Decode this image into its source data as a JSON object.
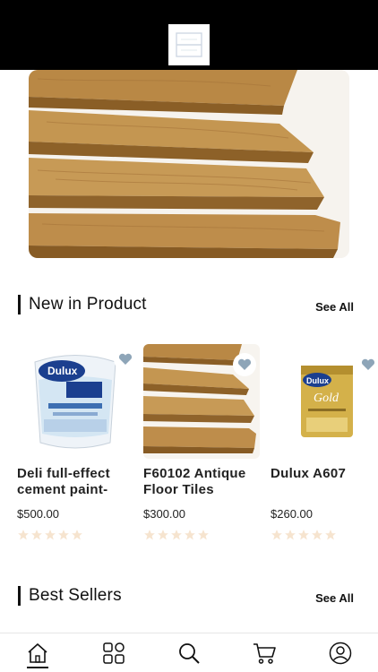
{
  "header": {
    "logo_icon": "store-logo-icon"
  },
  "banner": {
    "image": "wood-floor-planks"
  },
  "new_in_product": {
    "title": "New in Product",
    "see_all": "See All",
    "items": [
      {
        "name": "Deli full-effect cement paint-",
        "price": "$500.00",
        "rating": 0,
        "image": "dulux-paint-bucket"
      },
      {
        "name": "F60102 Antique Floor Tiles",
        "price": "$300.00",
        "rating": 0,
        "image": "wood-floor-planks"
      },
      {
        "name": "Dulux A607",
        "price": "$260.00",
        "rating": 0,
        "image": "dulux-gold-can"
      }
    ]
  },
  "best_sellers": {
    "title": "Best Sellers",
    "see_all": "See All"
  },
  "bottom_nav": [
    {
      "icon": "home-icon",
      "active": true
    },
    {
      "icon": "categories-icon",
      "active": false
    },
    {
      "icon": "search-icon",
      "active": false
    },
    {
      "icon": "cart-icon",
      "active": false
    },
    {
      "icon": "profile-icon",
      "active": false
    }
  ],
  "colors": {
    "star": "#f6e4cf",
    "heart": "#8ea5b8",
    "topbar": "#000000"
  }
}
